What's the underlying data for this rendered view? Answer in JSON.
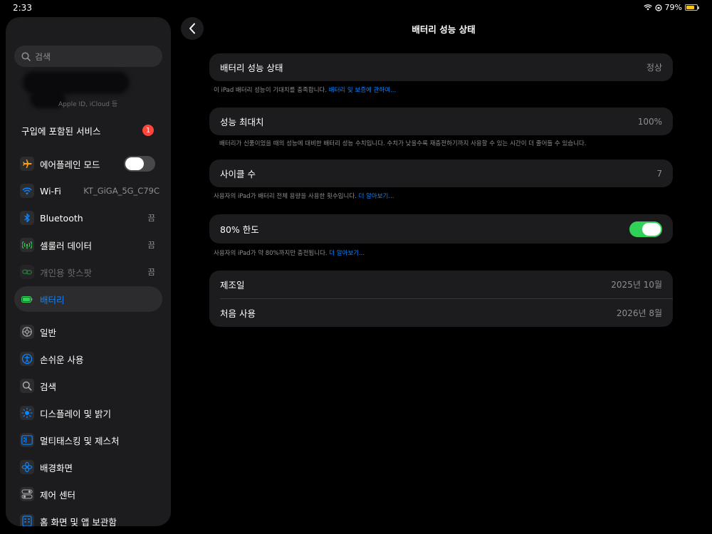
{
  "status": {
    "time": "2:33",
    "battery_pct": "79%"
  },
  "sidebar": {
    "search_placeholder": "검색",
    "account_sub": "Apple ID, iCloud 등",
    "purchase_services": {
      "label": "구입에 포함된 서비스",
      "badge": "1"
    },
    "items": [
      {
        "label": "에어플레인 모드",
        "icon": "airplane-icon",
        "color": "#ff9f0a",
        "toggle": false
      },
      {
        "label": "Wi-Fi",
        "icon": "wifi-icon",
        "color": "#0a84ff",
        "value": "KT_GiGA_5G_C79C"
      },
      {
        "label": "Bluetooth",
        "icon": "bluetooth-icon",
        "color": "#0a84ff",
        "value": "끔"
      },
      {
        "label": "셀룰러 데이터",
        "icon": "cellular-icon",
        "color": "#30d158",
        "value": "끔"
      },
      {
        "label": "개인용 핫스팟",
        "icon": "hotspot-icon",
        "color": "#30d158",
        "value": "끔"
      },
      {
        "label": "배터리",
        "icon": "battery-icon",
        "color": "#30d158"
      },
      {
        "label": "일반",
        "icon": "gear-icon",
        "color": "#8e8e93"
      },
      {
        "label": "손쉬운 사용",
        "icon": "accessibility-icon",
        "color": "#0a84ff"
      },
      {
        "label": "검색",
        "icon": "search-icon",
        "color": "#8e8e93"
      },
      {
        "label": "디스플레이 및 밝기",
        "icon": "brightness-icon",
        "color": "#0a84ff"
      },
      {
        "label": "멀티태스킹 및 제스처",
        "icon": "multitasking-icon",
        "color": "#0a84ff"
      },
      {
        "label": "배경화면",
        "icon": "wallpaper-icon",
        "color": "#0a84ff"
      },
      {
        "label": "제어 센터",
        "icon": "control-center-icon",
        "color": "#8e8e93"
      },
      {
        "label": "홈 화면 및 앱 보관함",
        "icon": "home-screen-icon",
        "color": "#0a84ff"
      }
    ]
  },
  "main": {
    "title": "배터리 성능 상태",
    "health": {
      "label": "배터리 성능 상태",
      "value": "정상",
      "footnote": "이 iPad 배터리 성능이 기대치를 충족합니다.",
      "footnote_link": "배터리 및 보증에 관하여..."
    },
    "max_capacity": {
      "label": "성능 최대치",
      "value": "100%",
      "footnote": "배터리가 신품이었을 때의 성능에 대비한 배터리 성능 수치입니다. 수치가 낮을수록 재충전하기까지 사용할 수 있는 시간이 더 줄어들 수 있습니다."
    },
    "cycle_count": {
      "label": "사이클 수",
      "value": "7",
      "footnote": "사용자의 iPad가 배터리 전체 용량을 사용한 횟수입니다.",
      "footnote_link": "더 알아보기..."
    },
    "limit_80": {
      "label": "80% 한도",
      "enabled": true,
      "footnote": "사용자의 iPad가 약 80%까지만 충전됩니다.",
      "footnote_link": "더 알아보기..."
    },
    "manufacture": {
      "label": "제조일",
      "value": "2025년 10월"
    },
    "first_use": {
      "label": "처음 사용",
      "value": "2026년 8월"
    }
  }
}
